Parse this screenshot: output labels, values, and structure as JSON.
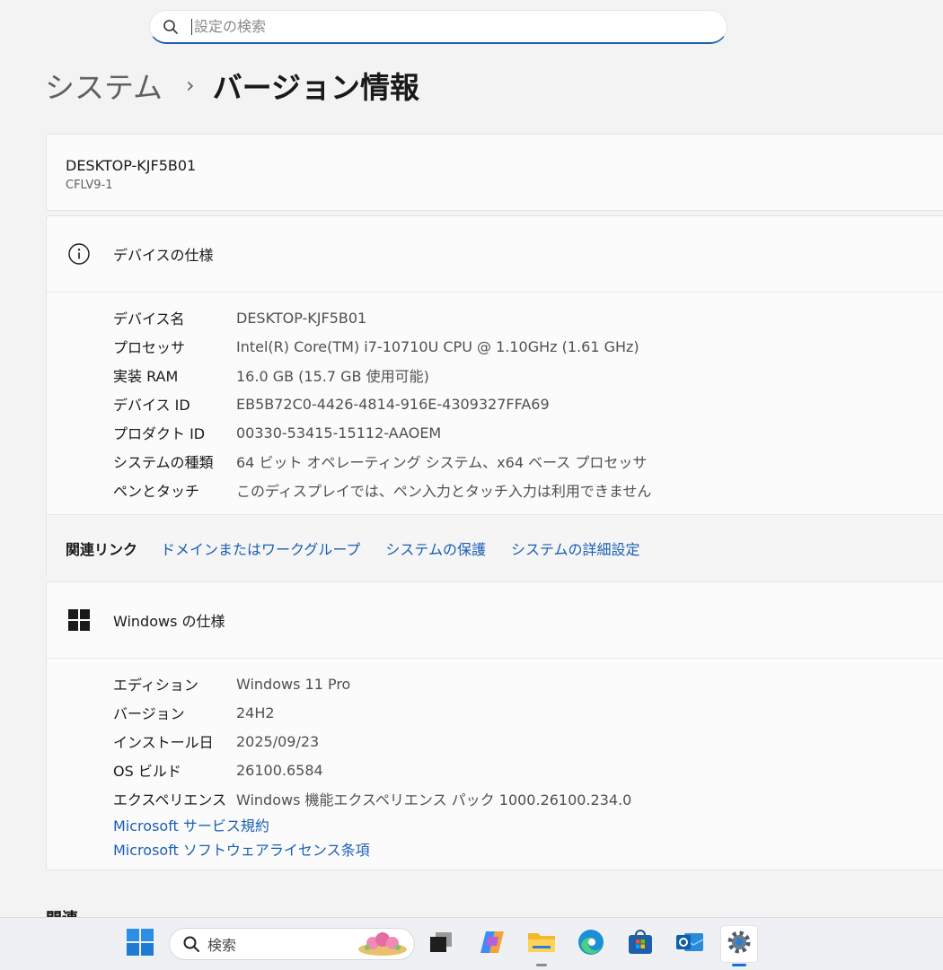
{
  "search": {
    "placeholder": "設定の検索"
  },
  "breadcrumb": {
    "parent": "システム",
    "separator": "›",
    "current": "バージョン情報"
  },
  "device": {
    "name": "DESKTOP-KJF5B01",
    "model": "CFLV9-1"
  },
  "device_specs": {
    "title": "デバイスの仕様",
    "icon": "info-icon",
    "rows": [
      {
        "key": "デバイス名",
        "value": "DESKTOP-KJF5B01"
      },
      {
        "key": "プロセッサ",
        "value": "Intel(R) Core(TM) i7-10710U CPU @ 1.10GHz (1.61 GHz)"
      },
      {
        "key": "実装 RAM",
        "value": "16.0 GB (15.7 GB 使用可能)"
      },
      {
        "key": "デバイス ID",
        "value": "EB5B72C0-4426-4814-916E-4309327FFA69"
      },
      {
        "key": "プロダクト ID",
        "value": "00330-53415-15112-AAOEM"
      },
      {
        "key": "システムの種類",
        "value": "64 ビット オペレーティング システム、x64 ベース プロセッサ"
      },
      {
        "key": "ペンとタッチ",
        "value": "このディスプレイでは、ペン入力とタッチ入力は利用できません"
      }
    ]
  },
  "related_links": {
    "label": "関連リンク",
    "links": [
      "ドメインまたはワークグループ",
      "システムの保護",
      "システムの詳細設定"
    ]
  },
  "windows_specs": {
    "title": "Windows の仕様",
    "icon": "windows-logo-icon",
    "rows": [
      {
        "key": "エディション",
        "value": "Windows 11 Pro"
      },
      {
        "key": "バージョン",
        "value": "24H2"
      },
      {
        "key": "インストール日",
        "value": "2025/09/23"
      },
      {
        "key": "OS ビルド",
        "value": "26100.6584"
      },
      {
        "key": "エクスペリエンス",
        "value": "Windows 機能エクスペリエンス パック 1000.26100.234.0"
      }
    ],
    "links": [
      "Microsoft サービス規約",
      "Microsoft ソフトウェアライセンス条項"
    ]
  },
  "related_heading": "関連",
  "taskbar": {
    "search_label": "検索",
    "apps": [
      "start-icon",
      "task-view-icon",
      "copilot-icon",
      "file-explorer-icon",
      "edge-icon",
      "store-icon",
      "outlook-icon",
      "settings-icon"
    ]
  },
  "colors": {
    "accent": "#1a5fb4",
    "background": "#f3f3f3",
    "card": "#fbfbfb"
  }
}
